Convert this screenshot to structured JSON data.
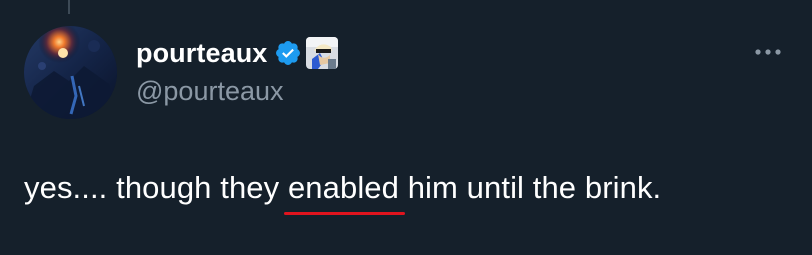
{
  "tweet": {
    "author": {
      "display_name": "pourteaux",
      "handle": "@pourteaux",
      "avatar": "avatar-image",
      "verified_badge": "verified-badge-icon",
      "affiliate_badge": "affiliate-badge-icon"
    },
    "text_before": "yes.... though they ",
    "text_highlight": "enabled",
    "text_after": " him until the brink.",
    "more_menu_icon": "more-icon",
    "highlight_color": "#e0141e"
  },
  "theme": {
    "background": "#15202b",
    "text_primary": "#ffffff",
    "text_secondary": "#8b98a5",
    "verified_blue": "#1d9bf0"
  }
}
